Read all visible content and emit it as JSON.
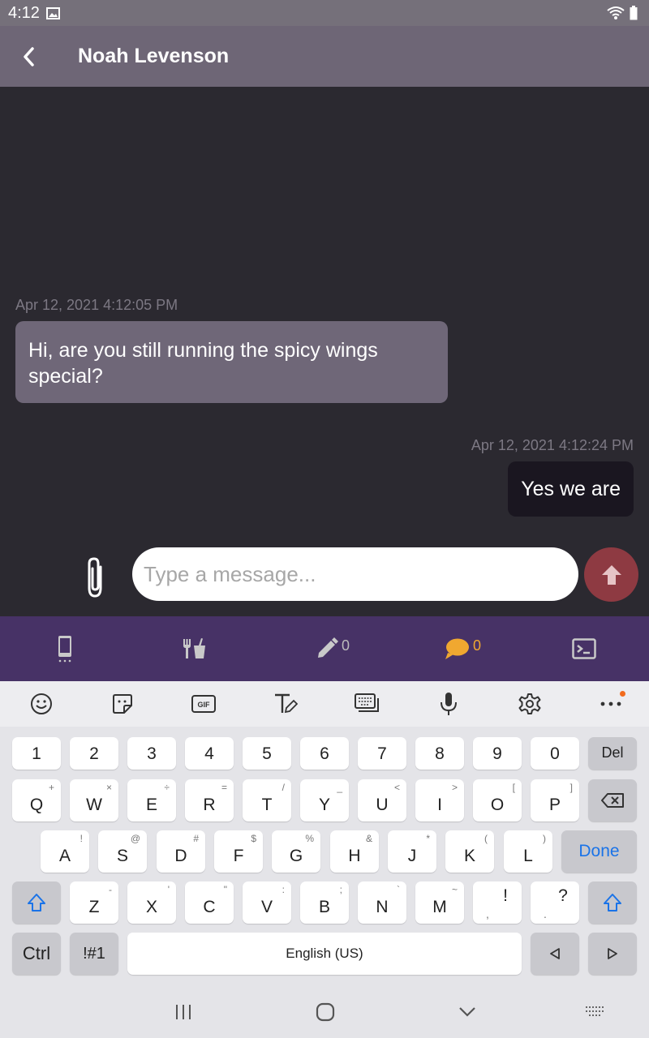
{
  "status": {
    "time": "4:12"
  },
  "header": {
    "title": "Noah Levenson"
  },
  "messages": [
    {
      "direction": "incoming",
      "timestamp": "Apr 12, 2021 4:12:05 PM",
      "text": "Hi, are you still running the spicy wings special?"
    },
    {
      "direction": "outgoing",
      "timestamp": "Apr 12, 2021 4:12:24 PM",
      "text": "Yes we are"
    }
  ],
  "composer": {
    "placeholder": "Type a message...",
    "value": ""
  },
  "tabs": [
    {
      "icon": "phone-icon"
    },
    {
      "icon": "utensils-icon"
    },
    {
      "icon": "pencil-icon",
      "count": "0"
    },
    {
      "icon": "chat-bubble-icon",
      "count": "0",
      "active": true
    },
    {
      "icon": "terminal-icon"
    }
  ],
  "keyboard": {
    "num_row": [
      "1",
      "2",
      "3",
      "4",
      "5",
      "6",
      "7",
      "8",
      "9",
      "0"
    ],
    "del_label": "Del",
    "row1": [
      [
        "Q",
        "+"
      ],
      [
        "W",
        "×"
      ],
      [
        "E",
        "÷"
      ],
      [
        "R",
        "="
      ],
      [
        "T",
        "/"
      ],
      [
        "Y",
        "_"
      ],
      [
        "U",
        "<"
      ],
      [
        "I",
        ">"
      ],
      [
        "O",
        "["
      ],
      [
        "P",
        "]"
      ]
    ],
    "row2": [
      [
        "A",
        "!"
      ],
      [
        "S",
        "@"
      ],
      [
        "D",
        "#"
      ],
      [
        "F",
        "$"
      ],
      [
        "G",
        "%"
      ],
      [
        "H",
        "&"
      ],
      [
        "J",
        "*"
      ],
      [
        "K",
        "("
      ],
      [
        "L",
        ")"
      ]
    ],
    "done_label": "Done",
    "row3": [
      [
        "Z",
        "-"
      ],
      [
        "X",
        "'"
      ],
      [
        "C",
        "\""
      ],
      [
        "V",
        ":"
      ],
      [
        "B",
        ";"
      ],
      [
        "N",
        "`"
      ],
      [
        "M",
        "~"
      ],
      [
        "!",
        ","
      ],
      [
        "?",
        "."
      ]
    ],
    "ctrl_label": "Ctrl",
    "sym_label": "!#1",
    "space_label": "English (US)"
  },
  "colors": {
    "accent_send": "#8e3a42",
    "tabbar": "#473266",
    "active_tab": "#f0a830",
    "done_blue": "#1a73e8"
  }
}
